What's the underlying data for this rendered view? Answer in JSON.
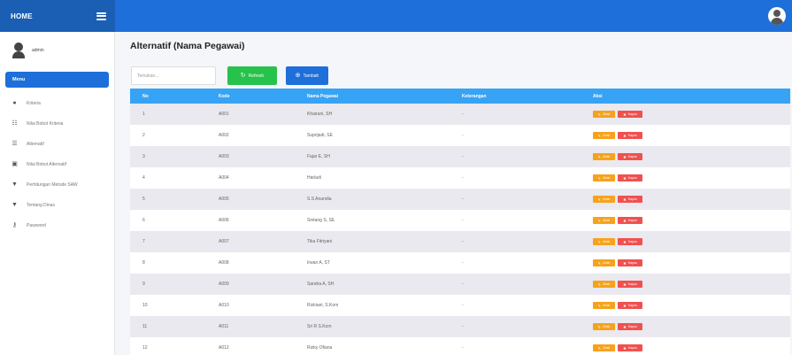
{
  "header": {
    "brand": "HOME"
  },
  "sidebar": {
    "username": "admin",
    "menu_header": "Menu",
    "items": [
      {
        "label": "Kriteria",
        "icon": "circle-icon"
      },
      {
        "label": "Nilai Bobot Kriteria",
        "icon": "table-icon"
      },
      {
        "label": "Alternatif",
        "icon": "list-icon"
      },
      {
        "label": "Nilai Bobot Alternatif",
        "icon": "edit-icon"
      },
      {
        "label": "Perhitungan Metode SAW",
        "icon": "filter-icon"
      },
      {
        "label": "Tentang Dinas",
        "icon": "filter-icon"
      },
      {
        "label": "Password",
        "icon": "key-icon"
      }
    ]
  },
  "main": {
    "title": "Alternatif (Nama Pegawai)",
    "search_placeholder": "Temukan...",
    "refresh_label": "Refresh",
    "tambah_label": "Tambah",
    "columns": [
      "No",
      "Kode",
      "Nama Pegawai",
      "Keterangan",
      "Aksi"
    ],
    "ubah_label": "Ubah",
    "hapus_label": "Hapus",
    "rows": [
      {
        "no": "1",
        "kode": "A001",
        "nama": "Khairani, SH",
        "ket": "-"
      },
      {
        "no": "2",
        "kode": "A002",
        "nama": "Suprijadi, SE",
        "ket": "-"
      },
      {
        "no": "3",
        "kode": "A003",
        "nama": "Fajar E, SH",
        "ket": "-"
      },
      {
        "no": "4",
        "kode": "A004",
        "nama": "Harladi",
        "ket": "-"
      },
      {
        "no": "5",
        "kode": "A005",
        "nama": "S.S Anandia",
        "ket": "-"
      },
      {
        "no": "6",
        "kode": "A006",
        "nama": "Sintang S, SE",
        "ket": "-"
      },
      {
        "no": "7",
        "kode": "A007",
        "nama": "Tika Fitriyani",
        "ket": "-"
      },
      {
        "no": "8",
        "kode": "A008",
        "nama": "Irwan A, ST",
        "ket": "-"
      },
      {
        "no": "9",
        "kode": "A009",
        "nama": "Sandra A, SH",
        "ket": "-"
      },
      {
        "no": "10",
        "kode": "A010",
        "nama": "Rizkiani, S.Kom",
        "ket": "-"
      },
      {
        "no": "11",
        "kode": "A011",
        "nama": "Sri R S.Kom",
        "ket": "-"
      },
      {
        "no": "12",
        "kode": "A012",
        "nama": "Rizky Ofiana",
        "ket": "-"
      }
    ]
  },
  "colors": {
    "brand": "#1a5fb4",
    "navbar": "#1e6fd9",
    "table_header": "#37a3f5",
    "refresh": "#27c24c",
    "ubah": "#f7a21b",
    "hapus": "#f0504f"
  }
}
